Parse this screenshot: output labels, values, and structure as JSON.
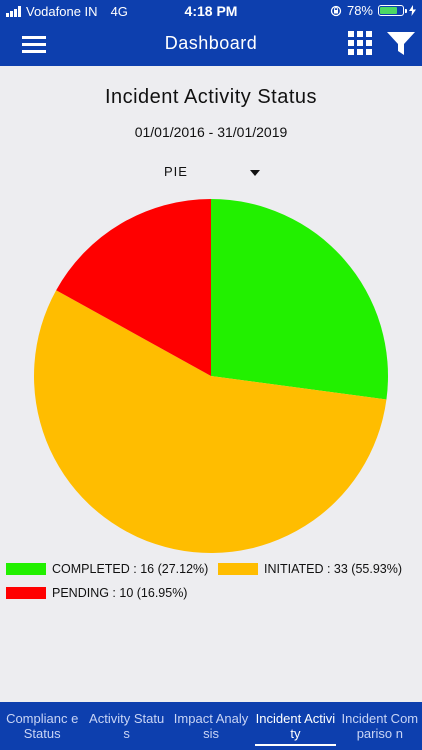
{
  "status_bar": {
    "carrier": "Vodafone IN",
    "network": "4G",
    "time": "4:18 PM",
    "battery_percent": "78%",
    "battery_level": 0.78,
    "battery_fill_color": "#4cd964"
  },
  "app_bar": {
    "title": "Dashboard",
    "background": "#0d3fae",
    "icons": [
      "menu-icon",
      "grid-icon",
      "filter-icon"
    ]
  },
  "main": {
    "title": "Incident Activity Status",
    "date_range": "01/01/2016 - 31/01/2019",
    "chart_type_selected": "PIE"
  },
  "chart_data": {
    "type": "pie",
    "slices": [
      {
        "label": "COMPLETED",
        "value": 16,
        "color": "#22f000"
      },
      {
        "label": "INITIATED",
        "value": 33,
        "color": "#ffbd00"
      },
      {
        "label": "PENDING",
        "value": 10,
        "color": "#ff0000"
      }
    ]
  },
  "legend": [
    {
      "text": "COMPLETED : 16 (27.12%)",
      "color": "#22f000"
    },
    {
      "text": "INITIATED : 33 (55.93%)",
      "color": "#ffbd00"
    },
    {
      "text": "PENDING : 10 (16.95%)",
      "color": "#ff0000"
    }
  ],
  "bottom_nav": {
    "tabs": [
      {
        "label": "Complianc e Status",
        "active": false
      },
      {
        "label": "Activity Status",
        "active": false
      },
      {
        "label": "Impact Analysis",
        "active": false
      },
      {
        "label": "Incident Activity",
        "active": true
      },
      {
        "label": "Incident Compariso n",
        "active": false
      }
    ]
  }
}
